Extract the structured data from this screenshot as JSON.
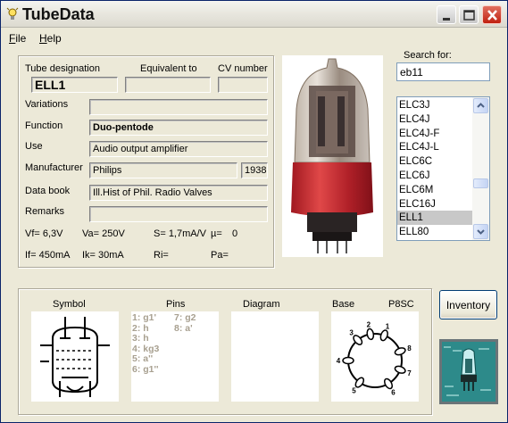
{
  "window": {
    "title": "TubeData"
  },
  "menu": {
    "file": "File",
    "file_mnemonic": "F",
    "file_rest": "ile",
    "help_mnemonic": "H",
    "help_rest": "elp"
  },
  "search": {
    "label": "Search for:",
    "value": "eb11"
  },
  "tube_list": {
    "items": [
      "ELC3J",
      "ELC4J",
      "ELC4J-F",
      "ELC4J-L",
      "ELC6C",
      "ELC6J",
      "ELC6M",
      "ELC16J",
      "ELL1",
      "ELL80"
    ],
    "selected": "ELL1"
  },
  "details": {
    "tube_designation_label": "Tube designation",
    "equivalent_label": "Equivalent to",
    "cv_label": "CV number",
    "tube_designation": "ELL1",
    "equivalent": "",
    "cv_number": "",
    "variations_label": "Variations",
    "variations": "",
    "function_label": "Function",
    "function": "Duo-pentode",
    "use_label": "Use",
    "use": "Audio output amplifier",
    "manufacturer_label": "Manufacturer",
    "manufacturer": "Philips",
    "year": "1938",
    "data_book_label": "Data book",
    "data_book": "Ill.Hist of Phil. Radio Valves",
    "remarks_label": "Remarks",
    "remarks": ""
  },
  "specs": {
    "vf": "Vf= 6,3V",
    "va": "Va= 250V",
    "s": "S= 1,7mA/V",
    "mu": "µ=",
    "mu_value": "0",
    "if": "If= 450mA",
    "ik": "Ik= 30mA",
    "ri": "Ri=",
    "pa": "Pa="
  },
  "lower": {
    "symbol_label": "Symbol",
    "pins_label": "Pins",
    "diagram_label": "Diagram",
    "base_label": "Base",
    "base_type": "P8SC",
    "pins_col1": [
      "1: g1'",
      "2: h",
      "3: h",
      "4: kg3",
      "5: a''",
      "6: g1''"
    ],
    "pins_col2": [
      "7: g2",
      "8: a'"
    ],
    "base_pins": [
      "1",
      "2",
      "3",
      "4",
      "5",
      "6",
      "7",
      "8"
    ]
  },
  "inventory_button": "Inventory",
  "colors": {
    "selection": "#c8c8c8",
    "pins_text": "#a8a090",
    "window_bg": "#ece9d8"
  }
}
